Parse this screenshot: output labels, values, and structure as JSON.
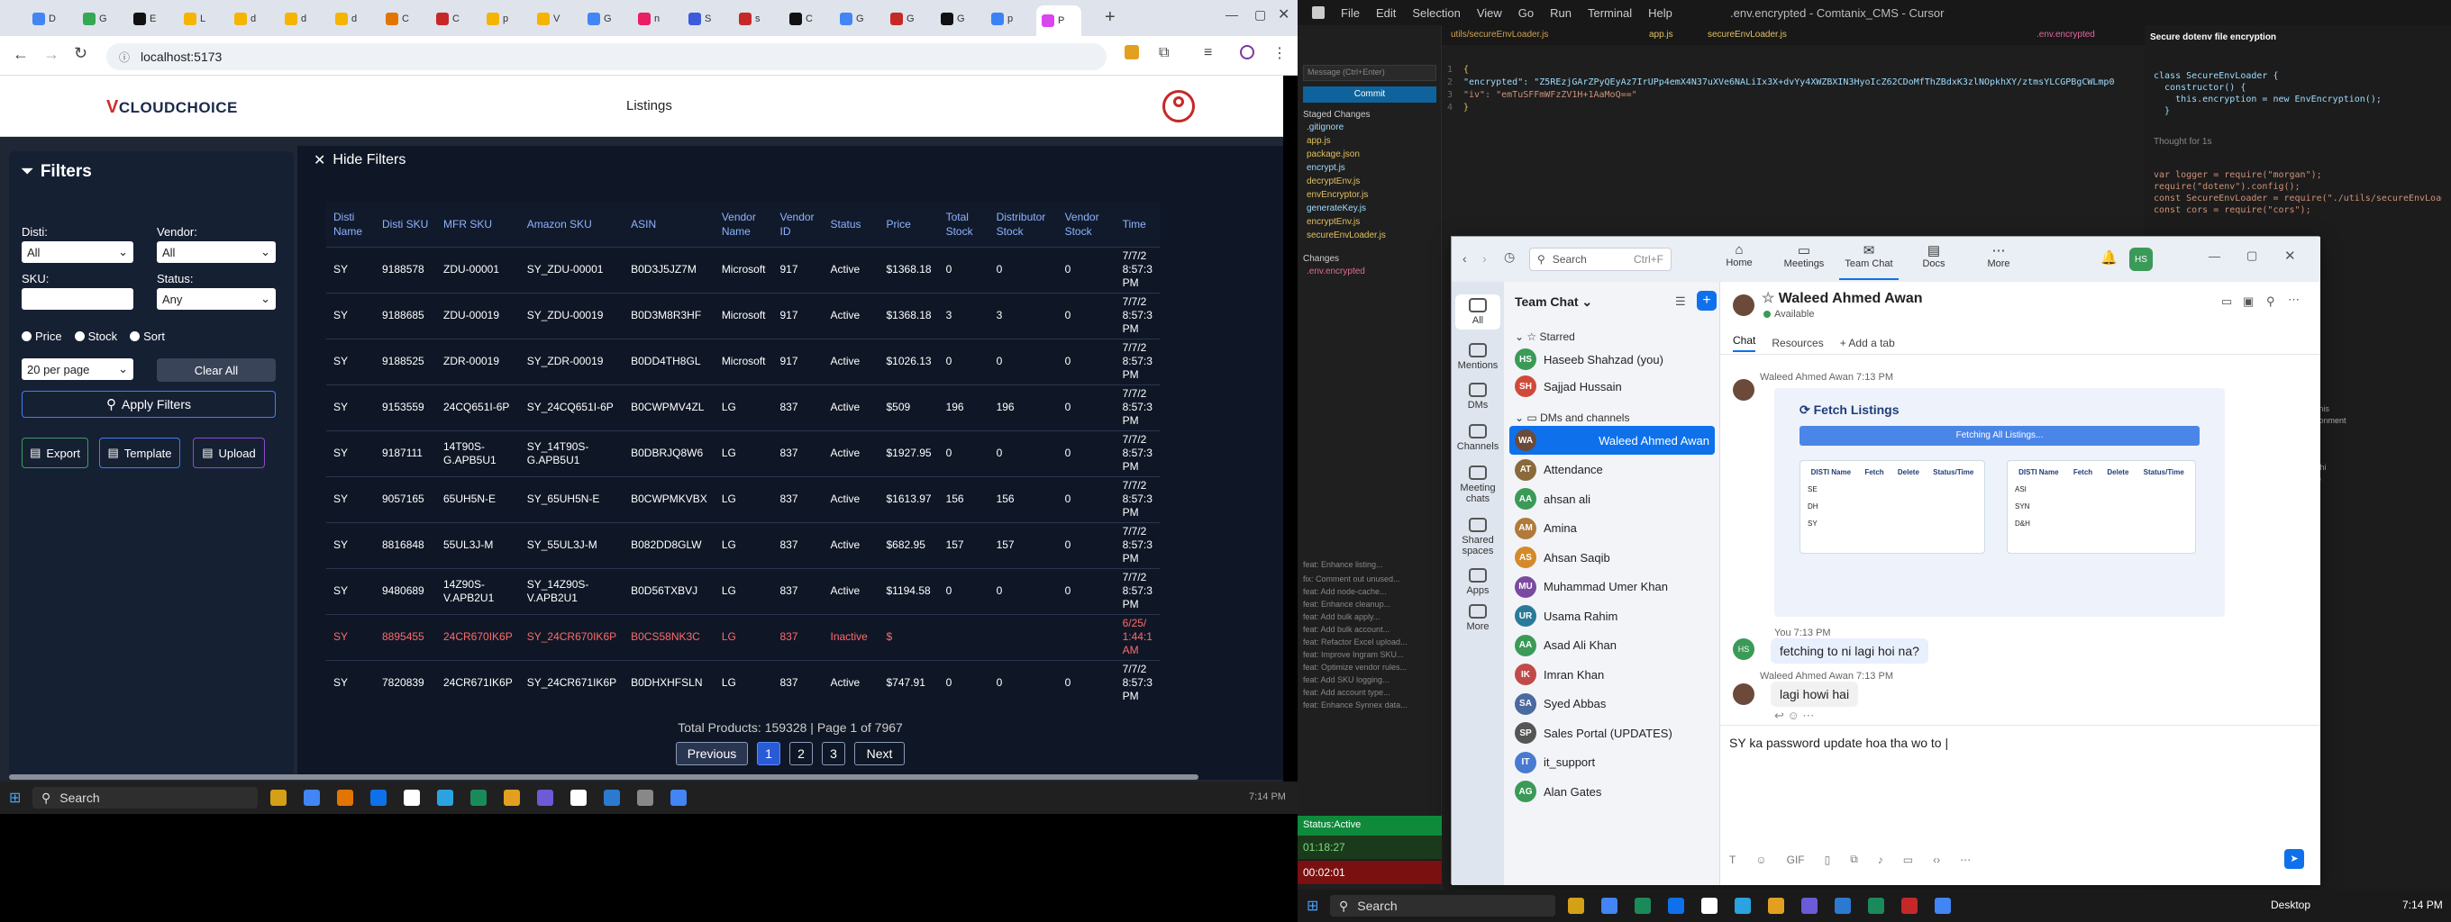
{
  "browser": {
    "tabs": [
      "D",
      "G",
      "E",
      "L",
      "d",
      "d",
      "d",
      "C",
      "C",
      "p",
      "V",
      "G",
      "n",
      "S",
      "s",
      "C",
      "G",
      "G",
      "G",
      "p",
      "P"
    ],
    "url": "localhost:5173"
  },
  "app": {
    "logo": "CLOUDCHOICE",
    "logo_mark": "V",
    "nav_listings": "Listings",
    "filters_title": "Filters",
    "hide_filters": "Hide Filters",
    "disti_label": "Disti:",
    "disti_value": "All",
    "vendor_label": "Vendor:",
    "vendor_value": "All",
    "sku_label": "SKU:",
    "status_label": "Status:",
    "status_value": "Any",
    "radio_price": "Price",
    "radio_stock": "Stock",
    "radio_sort": "Sort",
    "per_page": "20 per page",
    "clear_all": "Clear All",
    "apply_filters": "Apply Filters",
    "export": "Export",
    "template": "Template",
    "upload": "Upload",
    "columns": [
      "Disti Name",
      "Disti SKU",
      "MFR SKU",
      "Amazon SKU",
      "ASIN",
      "Vendor Name",
      "Vendor ID",
      "Status",
      "Price",
      "Total Stock",
      "Distributor Stock",
      "Vendor Stock",
      "Time"
    ],
    "rows": [
      [
        "SY",
        "9188578",
        "ZDU-00001",
        "SY_ZDU-00001",
        "B0D3J5JZ7M",
        "Microsoft",
        "917",
        "Active",
        "$1368.18",
        "0",
        "0",
        "0",
        "7/7/2 8:57:3 PM"
      ],
      [
        "SY",
        "9188685",
        "ZDU-00019",
        "SY_ZDU-00019",
        "B0D3M8R3HF",
        "Microsoft",
        "917",
        "Active",
        "$1368.18",
        "3",
        "3",
        "0",
        "7/7/2 8:57:3 PM"
      ],
      [
        "SY",
        "9188525",
        "ZDR-00019",
        "SY_ZDR-00019",
        "B0DD4TH8GL",
        "Microsoft",
        "917",
        "Active",
        "$1026.13",
        "0",
        "0",
        "0",
        "7/7/2 8:57:3 PM"
      ],
      [
        "SY",
        "9153559",
        "24CQ651I-6P",
        "SY_24CQ651I-6P",
        "B0CWPMV4ZL",
        "LG",
        "837",
        "Active",
        "$509",
        "196",
        "196",
        "0",
        "7/7/2 8:57:3 PM"
      ],
      [
        "SY",
        "9187111",
        "14T90S-G.APB5U1",
        "SY_14T90S-G.APB5U1",
        "B0DBRJQ8W6",
        "LG",
        "837",
        "Active",
        "$1927.95",
        "0",
        "0",
        "0",
        "7/7/2 8:57:3 PM"
      ],
      [
        "SY",
        "9057165",
        "65UH5N-E",
        "SY_65UH5N-E",
        "B0CWPMKVBX",
        "LG",
        "837",
        "Active",
        "$1613.97",
        "156",
        "156",
        "0",
        "7/7/2 8:57:3 PM"
      ],
      [
        "SY",
        "8816848",
        "55UL3J-M",
        "SY_55UL3J-M",
        "B082DD8GLW",
        "LG",
        "837",
        "Active",
        "$682.95",
        "157",
        "157",
        "0",
        "7/7/2 8:57:3 PM"
      ],
      [
        "SY",
        "9480689",
        "14Z90S-V.APB2U1",
        "SY_14Z90S-V.APB2U1",
        "B0D56TXBVJ",
        "LG",
        "837",
        "Active",
        "$1194.58",
        "0",
        "0",
        "0",
        "7/7/2 8:57:3 PM"
      ],
      [
        "SY",
        "8895455",
        "24CR670IK6P",
        "SY_24CR670IK6P",
        "B0CS58NK3C",
        "LG",
        "837",
        "Inactive",
        "$",
        "",
        "",
        "",
        "6/25/ 1:44:1 AM"
      ],
      [
        "SY",
        "7820839",
        "24CR671IK6P",
        "SY_24CR671IK6P",
        "B0DHXHFSLN",
        "LG",
        "837",
        "Active",
        "$747.91",
        "0",
        "0",
        "0",
        "7/7/2 8:57:3 PM"
      ]
    ],
    "total_text": "Total Products: 159328 | Page 1 of 7967",
    "prev": "Previous",
    "pages": [
      "1",
      "2",
      "3"
    ],
    "next": "Next"
  },
  "taskbar_left": {
    "search": "Search",
    "time": "7:14 PM"
  },
  "vscode": {
    "menu": [
      "File",
      "Edit",
      "Selection",
      "View",
      "Go",
      "Run",
      "Terminal",
      "Help"
    ],
    "title": ".env.encrypted - Comtanix_CMS - Cursor",
    "line1": "{",
    "line2": "  \"encrypted\": \"Z5REzjGArZPyQEyAz7IrUPp4emX4N37uXVe6NALiIx3X+dvYy4XWZBXIN3HyoIcZ62CDoMfThZBdxK3zlNOpkhXY/ztmsYLCGPBgCWLmp0",
    "line3": "  \"iv\": \"emTuSFFmWFzZV1H+1AaMoQ==\"",
    "line4": "}",
    "commit": "Commit",
    "staged": "Staged Changes",
    "changes": "Changes",
    "files": [
      ".gitignore",
      "app.js",
      "package.json",
      "encrypt.js",
      "decryptEnv.js",
      "envEncryptor.js",
      "generateKey.js",
      "encryptEnv.js",
      "secureEnvLoader.js",
      ".env.encrypted"
    ],
    "right_title": "Secure dotenv file encryption",
    "right_code": [
      "class SecureEnvLoader {",
      "  constructor() {",
      "    this.encryption = new EnvEncryption();",
      "  }"
    ],
    "thought": "Thought for 1s",
    "app_snip": [
      "var logger = require(\"morgan\");",
      "require(\"dotenv\").config();",
      "const SecureEnvLoader = require(\"./utils/secureEnvLoader\");",
      "const cors = require(\"cors\");"
    ]
  },
  "zoom": {
    "search": "Search",
    "search_hint": "Ctrl+F",
    "tabs": [
      "Home",
      "Meetings",
      "Team Chat",
      "Docs",
      "More"
    ],
    "rail": [
      "All",
      "Mentions",
      "DMs",
      "Channels",
      "Meeting chats",
      "Shared spaces",
      "Apps",
      "More"
    ],
    "list_title": "Team Chat",
    "starred": "Starred",
    "dms_channels": "DMs and channels",
    "starred_items": [
      {
        "initials": "HS",
        "name": "Haseeb Shahzad (you)",
        "color": "#3b9a57"
      },
      {
        "initials": "SH",
        "name": "Sajjad Hussain",
        "color": "#d04a3a"
      }
    ],
    "items": [
      {
        "initials": "WA",
        "name": "Waleed Ahmed Awan",
        "color": "#6b4a3a"
      },
      {
        "initials": "AT",
        "name": "Attendance",
        "color": "#8a6a3a"
      },
      {
        "initials": "AA",
        "name": "ahsan ali",
        "color": "#3b9a57"
      },
      {
        "initials": "AM",
        "name": "Amina",
        "color": "#b07a3a"
      },
      {
        "initials": "AS",
        "name": "Ahsan Saqib",
        "color": "#d48a2a"
      },
      {
        "initials": "MU",
        "name": "Muhammad Umer Khan",
        "color": "#7a4aa0"
      },
      {
        "initials": "UR",
        "name": "Usama Rahim",
        "color": "#2a7a9a"
      },
      {
        "initials": "AA",
        "name": "Asad Ali Khan",
        "color": "#3b9a57"
      },
      {
        "initials": "IK",
        "name": "Imran Khan",
        "color": "#c04a4a"
      },
      {
        "initials": "SA",
        "name": "Syed Abbas",
        "color": "#4a6aa0"
      },
      {
        "initials": "SP",
        "name": "Sales Portal (UPDATES)",
        "color": "#555"
      },
      {
        "initials": "IT",
        "name": "it_support",
        "color": "#4a7ad0"
      },
      {
        "initials": "AG",
        "name": "Alan Gates",
        "color": "#3b9a57"
      }
    ],
    "chat_name": "Waleed Ahmed Awan",
    "chat_status": "Available",
    "chat_tab": "Chat",
    "resources_tab": "Resources",
    "add_tab": "Add a tab",
    "msg1_meta": "Waleed Ahmed Awan 7:13 PM",
    "image_title": "Fetch Listings",
    "image_button": "Fetching All Listings...",
    "image_cols": [
      "DISTI Name",
      "Fetch",
      "Delete",
      "Status/Time"
    ],
    "image_rows_a": [
      "SE",
      "DH",
      "SY"
    ],
    "image_rows_b": [
      "ASI",
      "SYN",
      "D&H"
    ],
    "msg2_meta": "You 7:13 PM",
    "msg2": "fetching to ni lagi hoi na?",
    "msg3_meta": "Waleed Ahmed Awan 7:13 PM",
    "msg3": "lagi howi hai",
    "compose": "SY ka password update hoa tha wo to",
    "compose_icons": [
      "T",
      "GIF"
    ]
  },
  "taskbar_right": {
    "search": "Search",
    "desktop": "Desktop",
    "time": "7:14 PM",
    "status": "Status:Active",
    "t1": "01:18:27",
    "t2": "00:02:01"
  },
  "colors": {
    "accent": "#3d7eff",
    "danger": "#ff6a6a",
    "zoom_blue": "#0e71eb",
    "app_bg": "#1f2634"
  }
}
